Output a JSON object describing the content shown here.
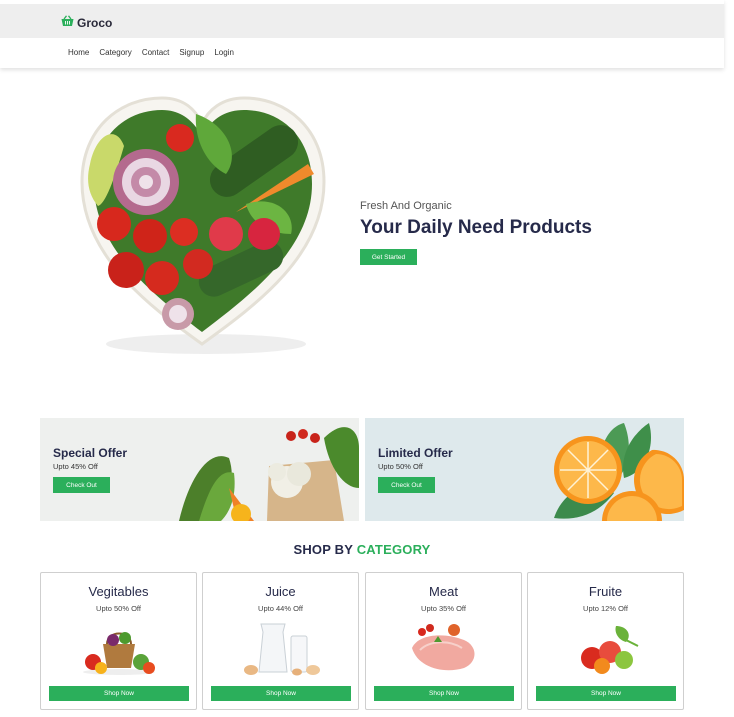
{
  "brand": {
    "name": "Groco",
    "icon": "basket-icon"
  },
  "nav": [
    "Home",
    "Category",
    "Contact",
    "Signup",
    "Login"
  ],
  "hero": {
    "subtitle": "Fresh And Organic",
    "title": "Your Daily Need Products",
    "button": "Get Started"
  },
  "offers": [
    {
      "title": "Special Offer",
      "subtitle": "Upto 45% Off",
      "button": "Check Out"
    },
    {
      "title": "Limited Offer",
      "subtitle": "Upto 50% Off",
      "button": "Check Out"
    }
  ],
  "section": {
    "title_prefix": "SHOP BY",
    "title_accent": "CATEGORY"
  },
  "categories": [
    {
      "name": "Vegitables",
      "offer": "Upto 50% Off",
      "button": "Shop Now"
    },
    {
      "name": "Juice",
      "offer": "Upto 44% Off",
      "button": "Shop Now"
    },
    {
      "name": "Meat",
      "offer": "Upto 35% Off",
      "button": "Shop Now"
    },
    {
      "name": "Fruite",
      "offer": "Upto 12% Off",
      "button": "Shop Now"
    }
  ],
  "colors": {
    "accent": "#2baf5b",
    "heading": "#262a4a",
    "brandbar": "#eeeeee"
  }
}
